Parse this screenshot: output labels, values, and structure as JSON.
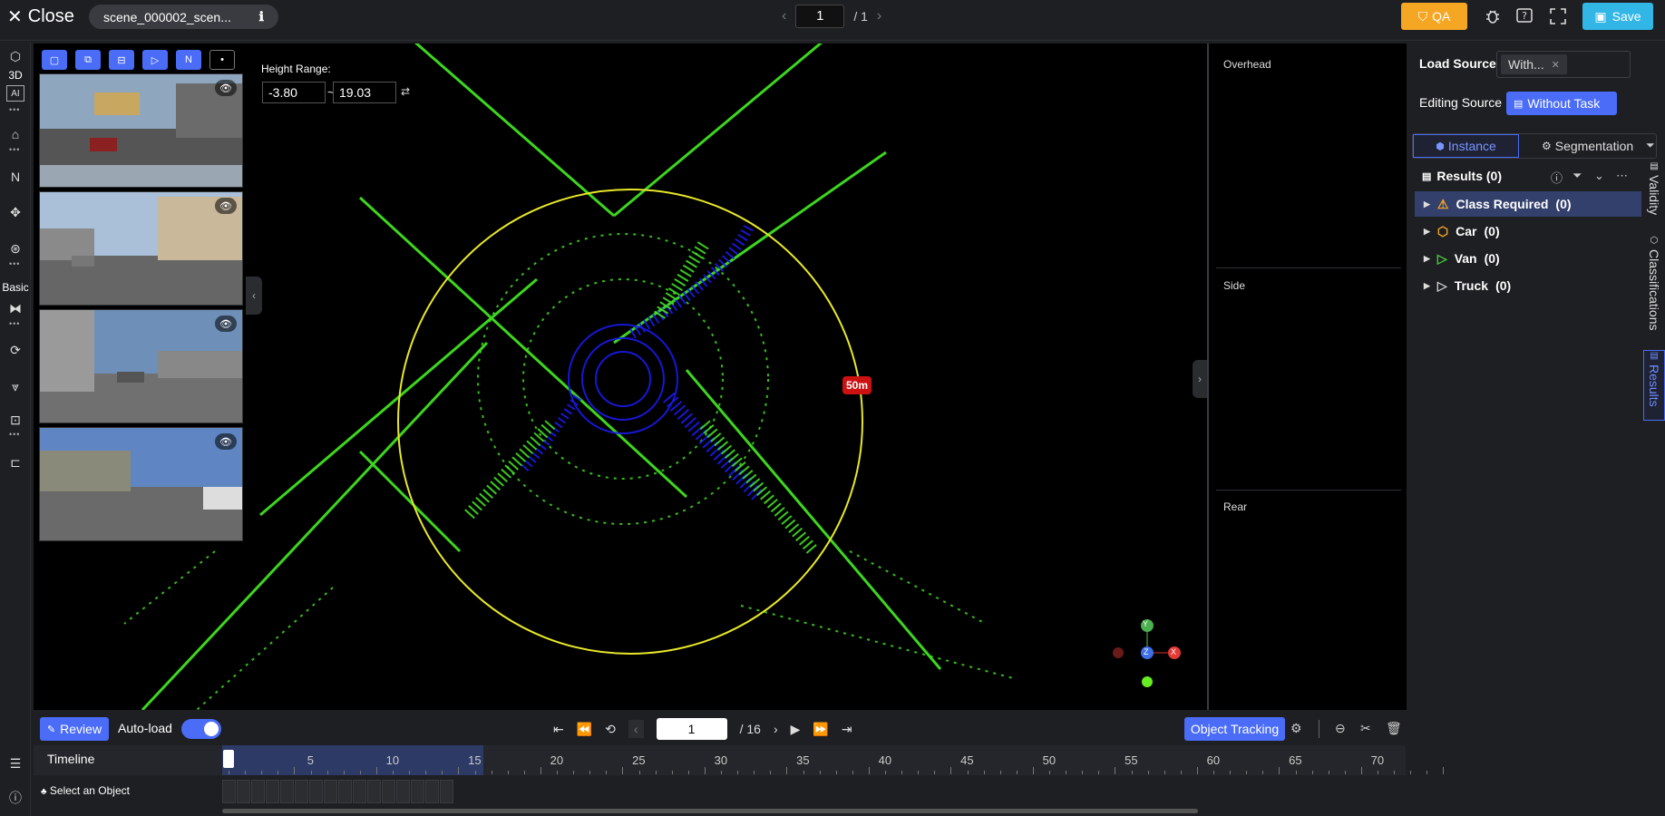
{
  "topbar": {
    "close_label": "Close",
    "scene_name": "scene_000002_scen...",
    "page_current": "1",
    "page_total": "/ 1",
    "qa_label": "QA",
    "save_label": "Save"
  },
  "left_toolbar": {
    "label_3d": "3D",
    "label_basic": "Basic"
  },
  "viewport": {
    "height_range_label": "Height Range:",
    "height_min": "-3.80",
    "height_sep": "~",
    "height_max": "19.03",
    "radius_label": "50m",
    "axis_y": "Y",
    "axis_z": "Z",
    "axis_x": "X"
  },
  "side_views": {
    "overhead": "Overhead",
    "side": "Side",
    "rear": "Rear"
  },
  "right_panel": {
    "load_source_label": "Load Source",
    "load_source_value": "With...",
    "editing_source_label": "Editing Source",
    "editing_source_value": "Without Task",
    "tab_instance": "Instance",
    "tab_segmentation": "Segmentation",
    "results_header": "Results (0)",
    "results": [
      {
        "label": "Class Required",
        "count": "(0)",
        "icon": "warning-icon",
        "color": "#f5a623"
      },
      {
        "label": "Car",
        "count": "(0)",
        "icon": "cube-icon",
        "color": "#f5a623"
      },
      {
        "label": "Van",
        "count": "(0)",
        "icon": "polygon-icon",
        "color": "#4ccc3a"
      },
      {
        "label": "Truck",
        "count": "(0)",
        "icon": "polygon-icon",
        "color": "#cccccc"
      }
    ],
    "vtabs": [
      "Validity",
      "Classifications",
      "Results"
    ]
  },
  "bottom": {
    "review_label": "Review",
    "autoload_label": "Auto-load",
    "autoload_on": true,
    "frame_current": "1",
    "frame_total": "/ 16",
    "object_tracking_label": "Object Tracking",
    "timeline_label": "Timeline",
    "select_object_label": "Select an Object",
    "ticks": [
      "5",
      "10",
      "15",
      "20",
      "25",
      "30",
      "35",
      "40",
      "45",
      "50",
      "55",
      "60",
      "65",
      "70"
    ]
  },
  "colors": {
    "accent": "#4a6cf7",
    "qa": "#f5a623",
    "save": "#32b6e6",
    "points_green": "#44ee22",
    "points_blue": "#1a1aee",
    "range_circle": "#e8e82a",
    "radius_badge": "#cc1111"
  }
}
